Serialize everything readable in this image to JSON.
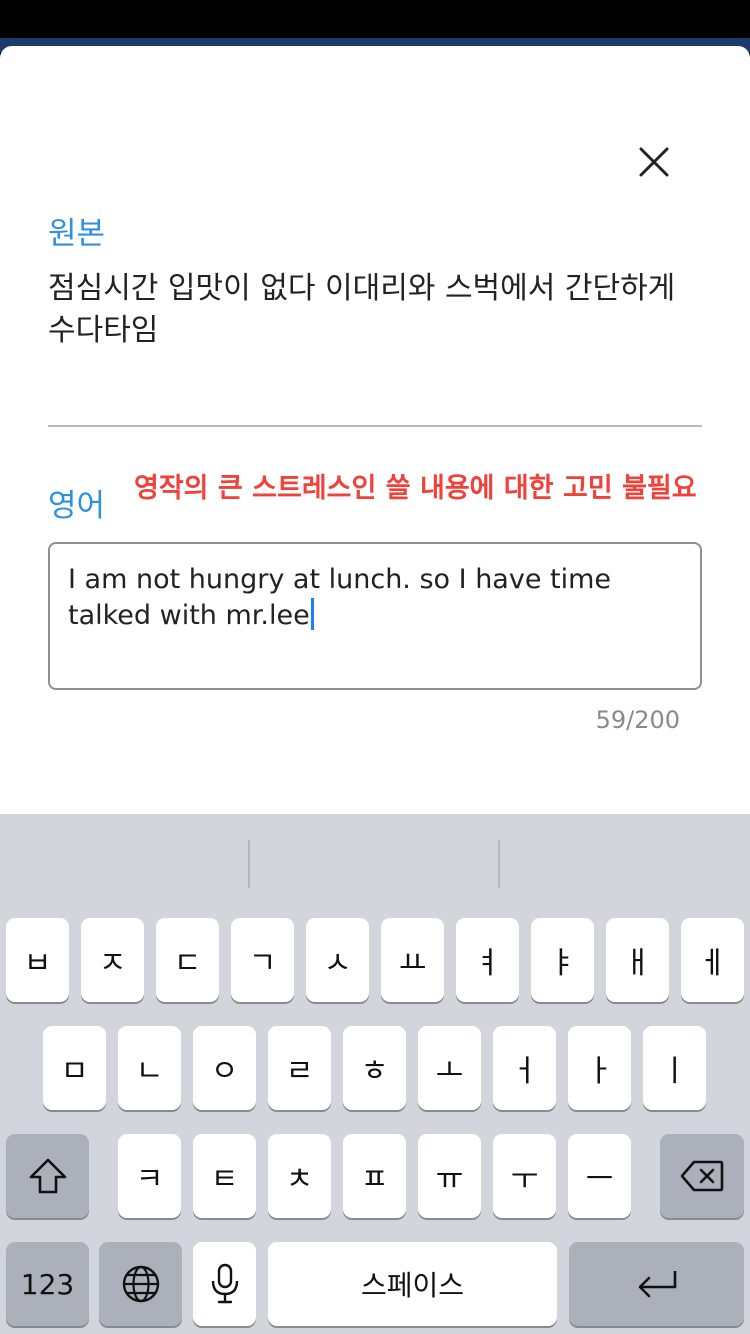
{
  "modal": {
    "source_label": "원본",
    "source_text": "점심시간 입맛이 없다 이대리와 스벅에서 간단하게 수다타임",
    "english_label": "영어",
    "annotation": "영작의 큰 스트레스인 쓸 내용에 대한 고민 불필요",
    "input_value": "I am not hungry at lunch. so I have time talked with mr.lee",
    "char_count": "59/200"
  },
  "keyboard": {
    "row1": [
      "ㅂ",
      "ㅈ",
      "ㄷ",
      "ㄱ",
      "ㅅ",
      "ㅛ",
      "ㅕ",
      "ㅑ",
      "ㅐ",
      "ㅔ"
    ],
    "row2": [
      "ㅁ",
      "ㄴ",
      "ㅇ",
      "ㄹ",
      "ㅎ",
      "ㅗ",
      "ㅓ",
      "ㅏ",
      "ㅣ"
    ],
    "row3": [
      "ㅋ",
      "ㅌ",
      "ㅊ",
      "ㅍ",
      "ㅠ",
      "ㅜ",
      "ㅡ"
    ],
    "numbers_label": "123",
    "space_label": "스페이스"
  },
  "colors": {
    "accent_blue": "#2f8fe0",
    "annotation_red": "#f0413a",
    "caret_blue": "#1e7cff",
    "keyboard_bg": "#d2d5db"
  }
}
